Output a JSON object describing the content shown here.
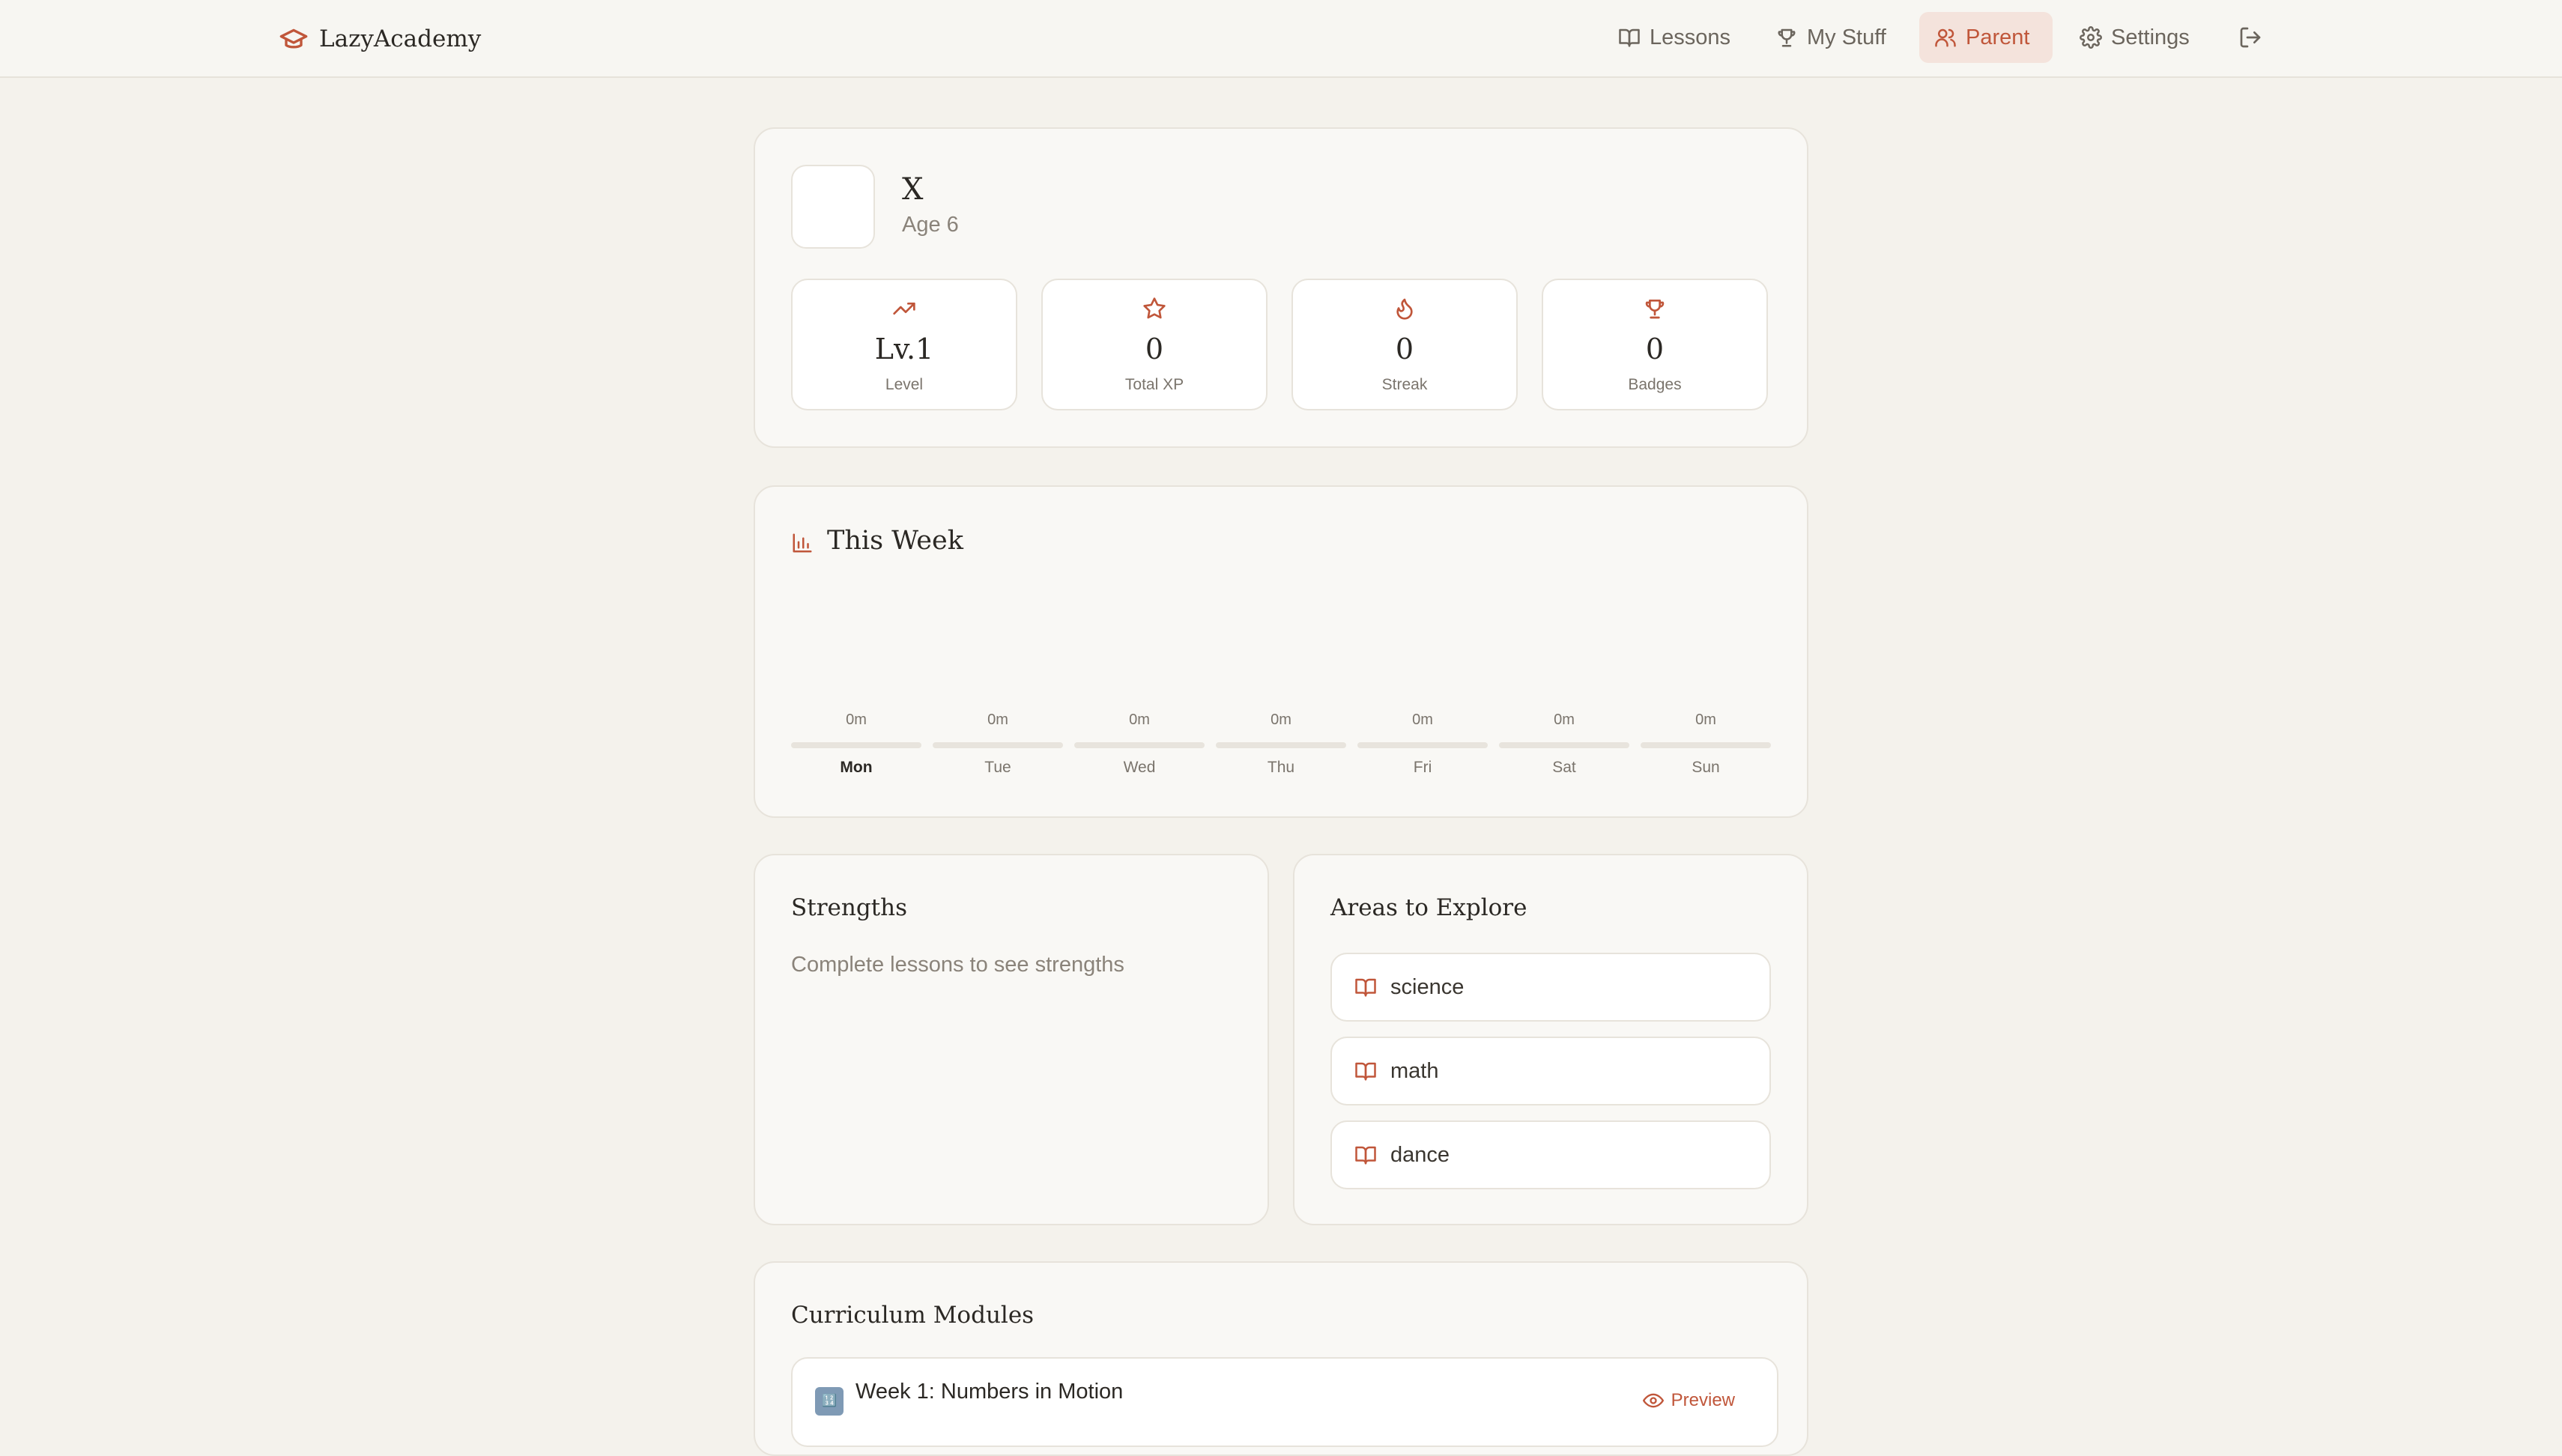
{
  "nav": {
    "brand": "LazyAcademy",
    "items": [
      {
        "label": "Lessons",
        "icon": "book-open-icon",
        "active": false
      },
      {
        "label": "My Stuff",
        "icon": "trophy-icon",
        "active": false
      },
      {
        "label": "Parent",
        "icon": "users-icon",
        "active": true
      },
      {
        "label": "Settings",
        "icon": "gear-icon",
        "active": false
      }
    ],
    "logout_icon": "logout-icon"
  },
  "profile": {
    "name": "X",
    "age": "Age 6",
    "stats": [
      {
        "value": "Lv.1",
        "label": "Level",
        "icon": "trending-up-icon"
      },
      {
        "value": "0",
        "label": "Total XP",
        "icon": "star-icon"
      },
      {
        "value": "0",
        "label": "Streak",
        "icon": "flame-icon"
      },
      {
        "value": "0",
        "label": "Badges",
        "icon": "trophy-icon"
      }
    ]
  },
  "week": {
    "title": "This Week",
    "days": [
      {
        "name": "Mon",
        "minutes": "0m",
        "today": true
      },
      {
        "name": "Tue",
        "minutes": "0m",
        "today": false
      },
      {
        "name": "Wed",
        "minutes": "0m",
        "today": false
      },
      {
        "name": "Thu",
        "minutes": "0m",
        "today": false
      },
      {
        "name": "Fri",
        "minutes": "0m",
        "today": false
      },
      {
        "name": "Sat",
        "minutes": "0m",
        "today": false
      },
      {
        "name": "Sun",
        "minutes": "0m",
        "today": false
      }
    ]
  },
  "strengths": {
    "title": "Strengths",
    "empty_text": "Complete lessons to see strengths"
  },
  "areas": {
    "title": "Areas to Explore",
    "items": [
      "science",
      "math",
      "dance"
    ]
  },
  "curriculum": {
    "title": "Curriculum Modules",
    "modules": [
      {
        "title": "Week 1: Numbers in Motion",
        "emoji": "🔢",
        "action": "Preview"
      }
    ]
  },
  "colors": {
    "accent": "#c0563a",
    "background": "#f4f2ec",
    "card": "#f9f8f5"
  }
}
